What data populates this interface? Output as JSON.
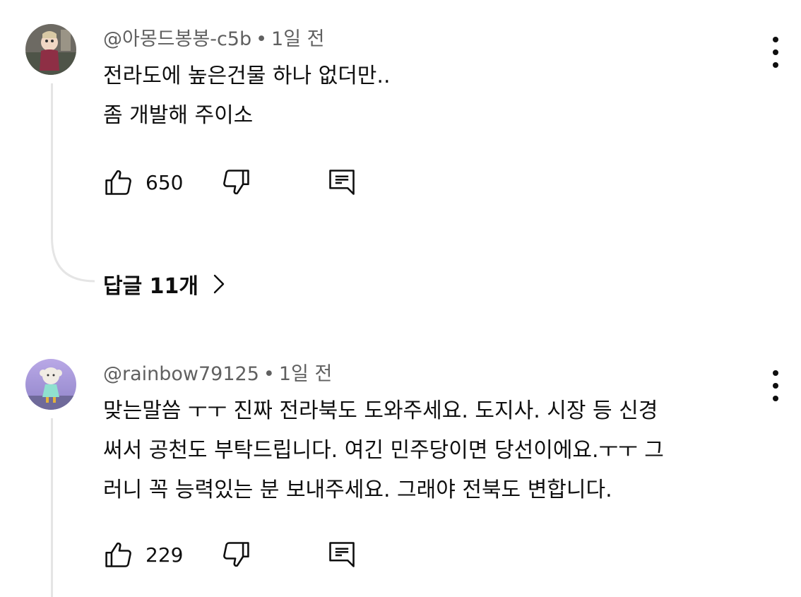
{
  "comments": [
    {
      "author": "@아몽드봉봉-c5b",
      "separator": "•",
      "time": "1일 전",
      "lines": [
        "전라도에 높은건물 하나 없더만..",
        "좀 개발해 주이소"
      ],
      "likes": "650",
      "avatar_colors": {
        "bg": "#6d6a63",
        "accent": "#8e2f45"
      }
    },
    {
      "author": "@rainbow79125",
      "separator": "•",
      "time": "1일 전",
      "lines": [
        "맞는말씀 ㅜㅜ  진짜 전라북도 도와주세요.   도지사. 시장  등  신경",
        "써서 공천도 부탁드립니다.  여긴 민주당이면 당선이에요.ㅜㅜ   그",
        "러니 꼭 능력있는 분 보내주세요. 그래야 전북도 변합니다."
      ],
      "likes": "229",
      "avatar_colors": {
        "bg": "#a79bd8",
        "accent": "#8fe0cf"
      }
    }
  ],
  "replies_label": "답글 11개",
  "icons": {
    "like": "thumbs-up-icon",
    "dislike": "thumbs-down-icon",
    "reply": "reply-comment-icon",
    "menu": "more-vertical-icon",
    "chevron": "chevron-right-icon"
  }
}
